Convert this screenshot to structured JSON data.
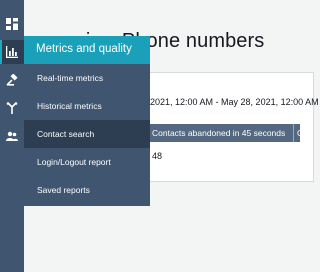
{
  "rail": {
    "icons": [
      "dashboard-icon",
      "metrics-icon",
      "routing-icon",
      "channels-icon",
      "users-icon"
    ],
    "active": "metrics-icon",
    "accent": "#1eaac1",
    "background": "#3f5570"
  },
  "page": {
    "title": "Historical metrics: Phone numbers",
    "visible_title_fragment": "ics: Phone numbers",
    "panel_label_fragment": "ge",
    "date_range_fragment": "2021, 12:00 AM - May 28, 2021, 12:00 AM",
    "table": {
      "header_visible": "Contacts abandoned in 45 seconds",
      "header_next_fragment": "C",
      "cell_value": "48"
    }
  },
  "flyout": {
    "header": "Metrics and quality",
    "header_color": "#1aa0b8",
    "items": [
      {
        "label": "Real-time metrics"
      },
      {
        "label": "Historical metrics"
      },
      {
        "label": "Contact search"
      },
      {
        "label": "Login/Logout report"
      },
      {
        "label": "Saved reports"
      }
    ],
    "hovered_item": "Contact search"
  }
}
